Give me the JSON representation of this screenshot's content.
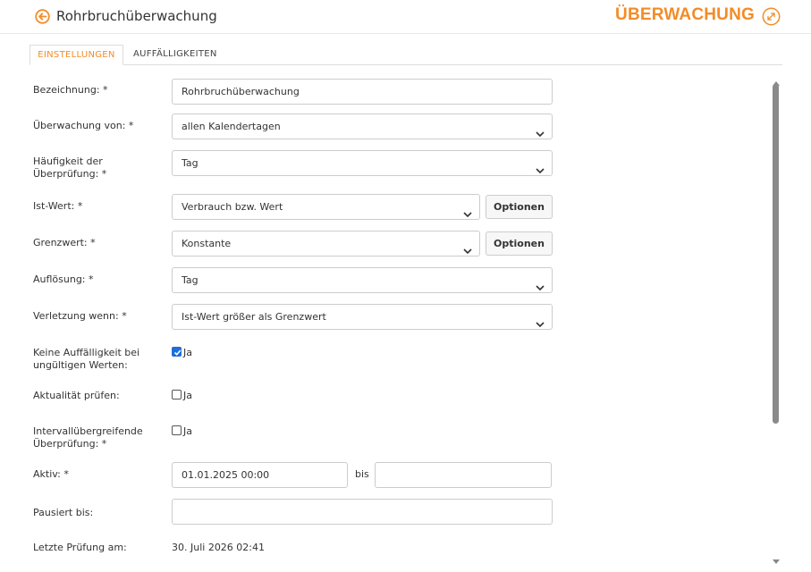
{
  "header": {
    "title": "Rohrbruchüberwachung",
    "brand": "ÜBERWACHUNG",
    "accent_color": "#f28c28",
    "back_icon": "arrow-left-circle-icon",
    "expand_icon": "expand-circle-icon"
  },
  "tabs": [
    {
      "label": "EINSTELLUNGEN",
      "active": true
    },
    {
      "label": "AUFFÄLLIGKEITEN",
      "active": false
    }
  ],
  "form": {
    "bezeichnung": {
      "label": "Bezeichnung: *",
      "value": "Rohrbruchüberwachung"
    },
    "ueberwachung_von": {
      "label": "Überwachung von: *",
      "value": "allen Kalendertagen"
    },
    "haeufigkeit": {
      "label_line1": "Häufigkeit der",
      "label_line2": "Überprüfung: *",
      "value": "Tag"
    },
    "ist_wert": {
      "label": "Ist-Wert: *",
      "value": "Verbrauch bzw. Wert",
      "button": "Optionen"
    },
    "grenzwert": {
      "label": "Grenzwert: *",
      "value": "Konstante",
      "button": "Optionen"
    },
    "aufloesung": {
      "label": "Auflösung: *",
      "value": "Tag"
    },
    "verletzung": {
      "label": "Verletzung wenn: *",
      "value": "Ist-Wert größer als Grenzwert"
    },
    "keine_auffaelligkeit": {
      "label_line1": "Keine Auffälligkeit bei",
      "label_line2": "ungültigen Werten:",
      "option": "Ja",
      "checked": true
    },
    "aktualitaet": {
      "label": "Aktualität prüfen:",
      "option": "Ja",
      "checked": false
    },
    "intervall": {
      "label_line1": "Intervallübergreifende",
      "label_line2": "Überprüfung: *",
      "option": "Ja",
      "checked": false
    },
    "aktiv": {
      "label": "Aktiv: *",
      "from": "01.01.2025 00:00",
      "separator": "bis",
      "to": ""
    },
    "pausiert": {
      "label": "Pausiert bis:",
      "value": ""
    },
    "letzte_pruefung": {
      "label": "Letzte Prüfung am:",
      "value": "30. Juli 2026 02:41"
    }
  }
}
